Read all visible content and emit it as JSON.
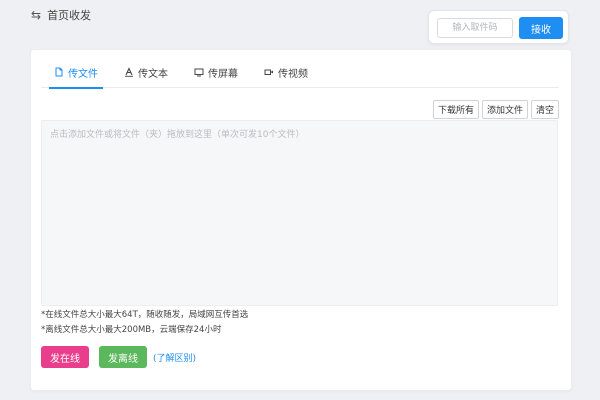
{
  "header": {
    "title": "首页收发",
    "icon": "swap-icon"
  },
  "receive": {
    "placeholder": "输入取件码",
    "button_label": "接收"
  },
  "tabs": [
    {
      "label": "传文件",
      "icon": "file-icon",
      "active": true
    },
    {
      "label": "传文本",
      "icon": "text-icon",
      "active": false
    },
    {
      "label": "传屏幕",
      "icon": "screen-icon",
      "active": false
    },
    {
      "label": "传视频",
      "icon": "video-icon",
      "active": false
    }
  ],
  "toolbar": {
    "download_all": "下载所有",
    "add_file": "添加文件",
    "clear": "清空"
  },
  "dropzone": {
    "hint": "点击添加文件或将文件（夹）拖放到这里（单次可发10个文件）"
  },
  "notes": [
    "*在线文件总大小最大64T，随收随发，局域网互传首选",
    "*离线文件总大小最大200MB，云端保存24小时"
  ],
  "actions": {
    "send_online": "发在线",
    "send_offline": "发离线",
    "learn_diff": "(了解区别)"
  },
  "colors": {
    "accent": "#1e8ef3",
    "online": "#e83e8c",
    "offline": "#5cb85c"
  }
}
